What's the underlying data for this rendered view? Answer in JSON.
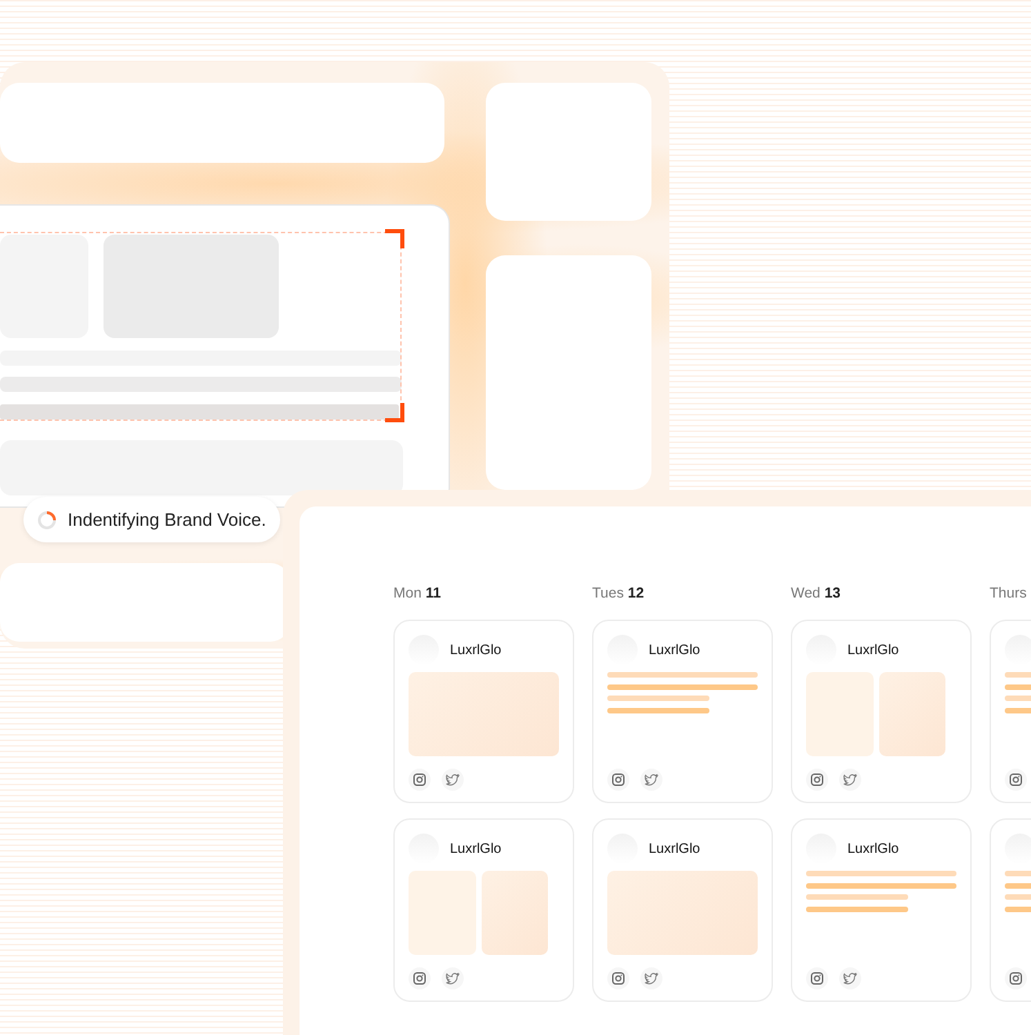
{
  "status_pill": {
    "text": "Indentifying Brand Voice."
  },
  "calendar": {
    "days": [
      {
        "label": "Mon",
        "number": "11",
        "posts": [
          {
            "account": "LuxrlGlo",
            "kind": "image",
            "icons": [
              {
                "kind": "camera"
              },
              {
                "kind": "bird"
              }
            ]
          },
          {
            "account": "LuxrlGlo",
            "kind": "two-images",
            "icons": [
              {
                "kind": "camera"
              },
              {
                "kind": "bird"
              }
            ]
          }
        ]
      },
      {
        "label": "Tues",
        "number": "12",
        "posts": [
          {
            "account": "LuxrlGlo",
            "kind": "text",
            "icons": [
              {
                "kind": "camera"
              },
              {
                "kind": "bird"
              }
            ]
          },
          {
            "account": "LuxrlGlo",
            "kind": "image",
            "icons": [
              {
                "kind": "camera"
              },
              {
                "kind": "bird"
              }
            ]
          }
        ]
      },
      {
        "label": "Wed",
        "number": "13",
        "posts": [
          {
            "account": "LuxrlGlo",
            "kind": "two-images",
            "icons": [
              {
                "kind": "camera"
              },
              {
                "kind": "bird"
              }
            ]
          },
          {
            "account": "LuxrlGlo",
            "kind": "text",
            "icons": [
              {
                "kind": "camera"
              },
              {
                "kind": "bird"
              }
            ]
          }
        ]
      },
      {
        "label": "Thurs",
        "posts": [
          {
            "kind": "text",
            "icons": [
              {
                "kind": "camera"
              }
            ]
          },
          {
            "kind": "text",
            "icons": [
              {
                "kind": "camera"
              }
            ]
          }
        ]
      }
    ]
  }
}
